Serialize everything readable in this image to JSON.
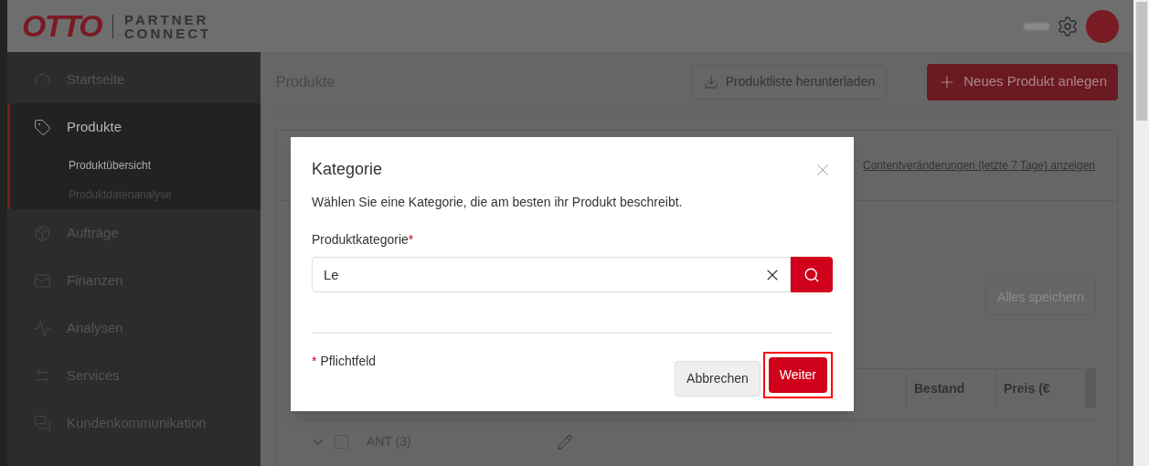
{
  "logo": {
    "brand": "OTTO",
    "line_1": "PARTNER",
    "line_2": "CONNECT"
  },
  "sidebar": {
    "items": [
      {
        "kind": "gauge",
        "label": "Startseite",
        "selected": false
      },
      {
        "kind": "tag",
        "label": "Produkte",
        "selected": true,
        "children": [
          {
            "label": "Produktübersicht",
            "selected": true
          },
          {
            "label": "Produktdatenanalyse",
            "selected": false
          }
        ]
      },
      {
        "kind": "box",
        "label": "Aufträge",
        "selected": false
      },
      {
        "kind": "money",
        "label": "Finanzen",
        "selected": false
      },
      {
        "kind": "chart",
        "label": "Analysen",
        "selected": false
      },
      {
        "kind": "services",
        "label": "Services",
        "selected": false
      },
      {
        "kind": "chat",
        "label": "Kundenkommunikation",
        "selected": false
      }
    ]
  },
  "page": {
    "title": "Produkte",
    "download_button": "Produktliste herunterladen",
    "new_button": "Neues Produkt anlegen",
    "changes_link": "Contentveränderungen (letzte 7 Tage) anzeigen",
    "save_button": "Alles speichern",
    "table": {
      "columns": [
        "Bestand",
        "Preis (€"
      ],
      "rows": [
        {
          "label": "ANT (3)",
          "checked": false
        }
      ]
    }
  },
  "dialog": {
    "title": "Kategorie",
    "description": "Wählen Sie eine Kategorie, die am besten ihr Produkt beschreibt.",
    "field_label": "Produktkategorie",
    "required_mark": "*",
    "field_value": "Le",
    "footnote_mark": "*",
    "footnote": "Pflichtfeld",
    "cancel_button": "Abbrechen",
    "next_button": "Weiter",
    "next_highlighted": true
  }
}
